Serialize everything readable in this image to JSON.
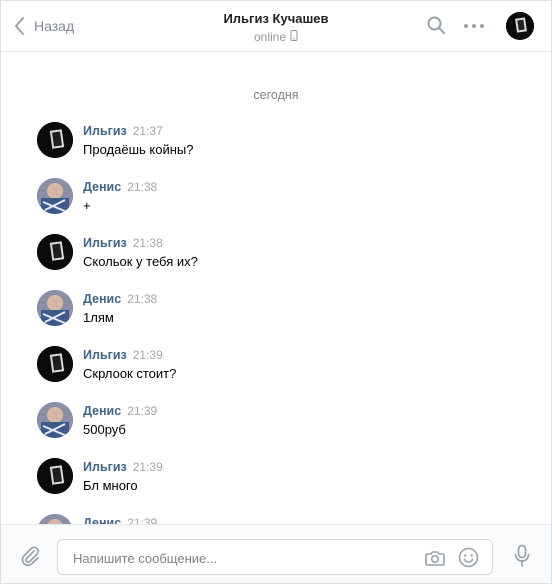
{
  "header": {
    "back_label": "Назад",
    "title": "Ильгиз Кучашев",
    "status": "online"
  },
  "history": {
    "date_separator": "сегодня",
    "messages": [
      {
        "author": "Ильгиз",
        "time": "21:37",
        "text": "Продаёшь койны?"
      },
      {
        "author": "Денис",
        "time": "21:38",
        "text": "+"
      },
      {
        "author": "Ильгиз",
        "time": "21:38",
        "text": "Скольок у тебя их?"
      },
      {
        "author": "Денис",
        "time": "21:38",
        "text": "1лям"
      },
      {
        "author": "Ильгиз",
        "time": "21:39",
        "text": "Скрлоок стоит?"
      },
      {
        "author": "Денис",
        "time": "21:39",
        "text": "500руб"
      },
      {
        "author": "Ильгиз",
        "time": "21:39",
        "text": "Бл много"
      },
      {
        "author": "Денис",
        "time": "21:39",
        "text": ""
      }
    ]
  },
  "composer": {
    "placeholder": "Напишите сообщение..."
  },
  "colors": {
    "author_link": "#42648b",
    "icon_gray": "#99a2ad"
  }
}
